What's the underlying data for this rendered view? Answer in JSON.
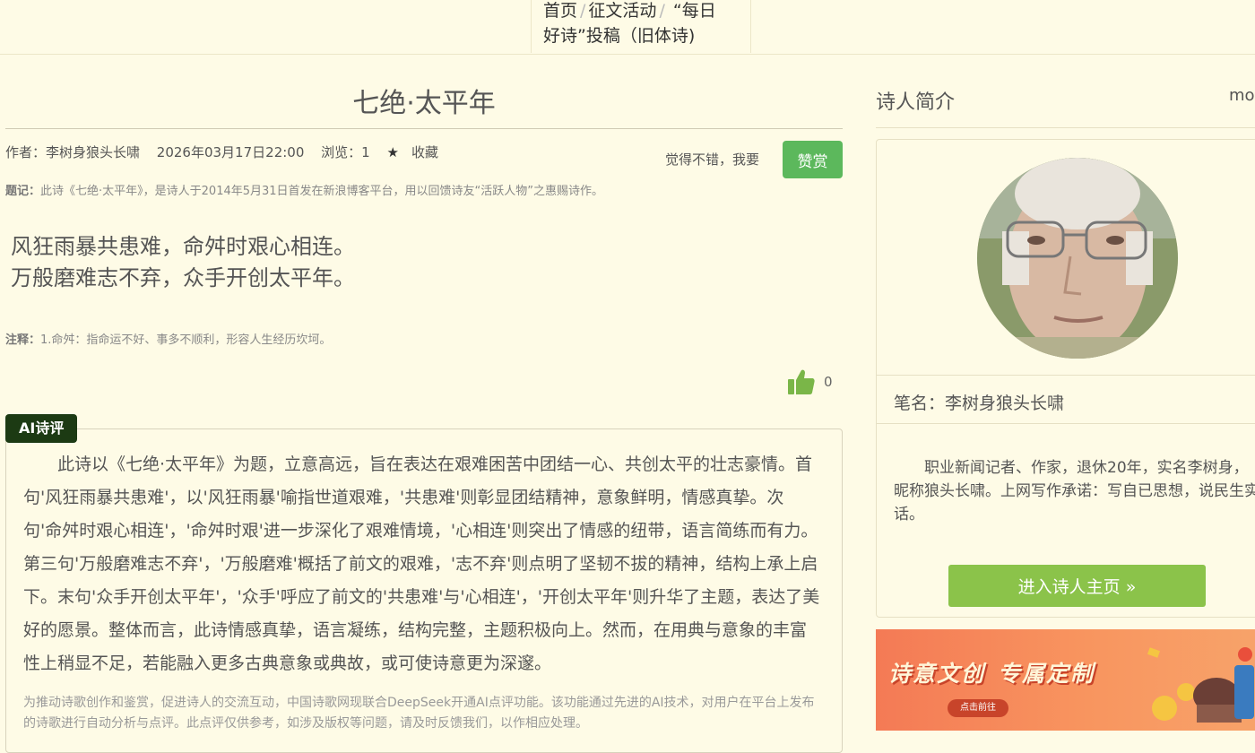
{
  "breadcrumb": {
    "home": "首页",
    "activity": "征文活动",
    "current_line1": "“每日",
    "current_line2": "好诗”投稿（旧体诗)"
  },
  "poem": {
    "title": "七绝·太平年",
    "author": "作者：李树身狼头长啸",
    "date": "2026年03月17日22:00",
    "views": "浏览：1",
    "favorite": "收藏",
    "like_text": "觉得不错，我要",
    "reward_button": "赞赏",
    "preface_label": "题记：",
    "preface": "此诗《七绝·太平年》，是诗人于2014年5月31日首发在新浪博客平台，用以回馈诗友“活跃人物”之惠赐诗作。",
    "lines": [
      "风狂雨暴共患难，命舛时艰心相连。",
      "万般磨难志不弃，众手开创太平年。"
    ],
    "note_label": "注释：",
    "note": "1.命舛：指命运不好、事多不顺利，形容人生经历坎坷。",
    "like_count": "0"
  },
  "ai_review": {
    "tag": "AI诗评",
    "text": "此诗以《七绝·太平年》为题，立意高远，旨在表达在艰难困苦中团结一心、共创太平的壮志豪情。首句'风狂雨暴共患难'，以'风狂雨暴'喻指世道艰难，'共患难'则彰显团结精神，意象鲜明，情感真挚。次句'命舛时艰心相连'，'命舛时艰'进一步深化了艰难情境，'心相连'则突出了情感的纽带，语言简练而有力。第三句'万般磨难志不弃'，'万般磨难'概括了前文的艰难，'志不弃'则点明了坚韧不拔的精神，结构上承上启下。末句'众手开创太平年'，'众手'呼应了前文的'共患难'与'心相连'，'开创太平年'则升华了主题，表达了美好的愿景。整体而言，此诗情感真挚，语言凝练，结构完整，主题积极向上。然而，在用典与意象的丰富性上稍显不足，若能融入更多古典意象或典故，或可使诗意更为深邃。",
    "disclaimer": "为推动诗歌创作和鉴赏，促进诗人的交流互动，中国诗歌网现联合DeepSeek开通AI点评功能。该功能通过先进的AI技术，对用户在平台上发布的诗歌进行自动分析与点评。此点评仅供参考，如涉及版权等问题，请及时反馈我们，以作相应处理。"
  },
  "sidebar": {
    "title": "诗人简介",
    "more": "more",
    "pen_name": "笔名：李树身狼头长啸",
    "bio": "职业新闻记者、作家，退休20年，实名李树身，昵称狼头长啸。上网写作承诺：写自已思想，说民生实话。",
    "home_button": "进入诗人主页 »",
    "banner_title_part1": "诗意文创",
    "banner_title_part2": "专属定制",
    "banner_tag": "点击前往"
  },
  "colors": {
    "background": "#fefbe6",
    "reward_green": "#5cb85c",
    "home_button_green": "#8bc34a",
    "ai_tag_dark_green": "#1c3a13",
    "thumb_green": "#7ab648"
  }
}
